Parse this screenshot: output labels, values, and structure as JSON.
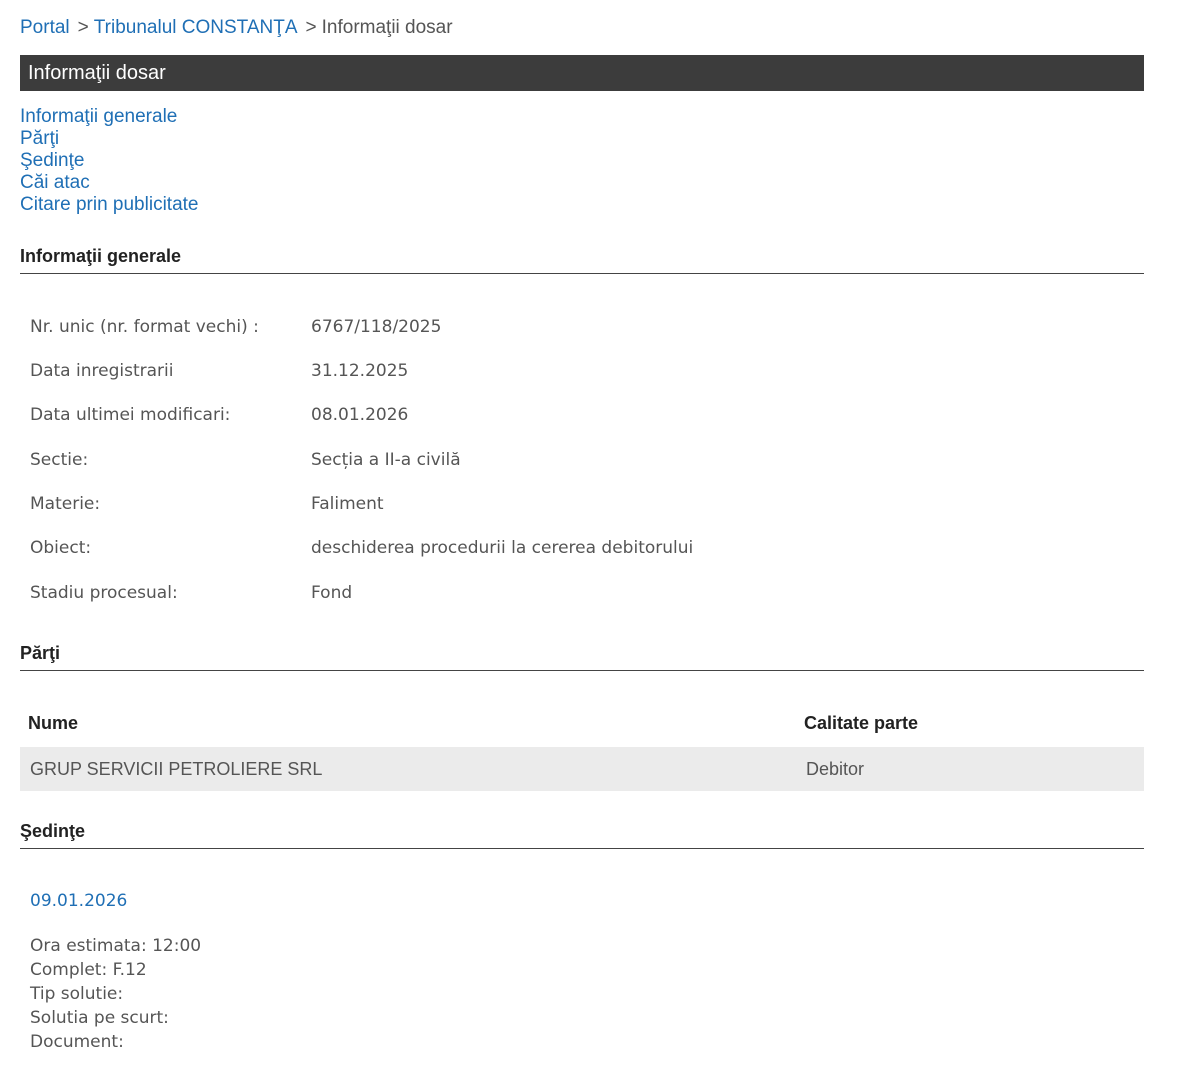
{
  "breadcrumb": {
    "portal": "Portal",
    "separator": ">",
    "court": "Tribunalul CONSTANŢA",
    "current": "Informaţii dosar"
  },
  "title_bar": "Informaţii dosar",
  "toc": [
    "Informaţii generale",
    "Părţi",
    "Şedinţe",
    "Căi atac",
    "Citare prin publicitate"
  ],
  "general": {
    "heading": "Informaţii generale",
    "rows": [
      {
        "label": "Nr. unic (nr. format vechi) :",
        "value": "6767/118/2025"
      },
      {
        "label": "Data inregistrarii",
        "value": "31.12.2025"
      },
      {
        "label": "Data ultimei modificari:",
        "value": "08.01.2026"
      },
      {
        "label": "Sectie:",
        "value": "Secția a II-a civilă"
      },
      {
        "label": "Materie:",
        "value": "Faliment"
      },
      {
        "label": "Obiect:",
        "value": "deschiderea procedurii la cererea debitorului"
      },
      {
        "label": "Stadiu procesual:",
        "value": "Fond"
      }
    ]
  },
  "parties": {
    "heading": "Părţi",
    "col_name": "Nume",
    "col_role": "Calitate parte",
    "rows": [
      {
        "name": "GRUP SERVICII PETROLIERE SRL",
        "role": "Debitor"
      }
    ]
  },
  "hearings": {
    "heading": "Şedinţe",
    "date": "09.01.2026",
    "details": [
      "Ora estimata: 12:00",
      "Complet: F.12",
      "Tip solutie:",
      "Solutia pe scurt:",
      "Document:"
    ]
  },
  "colors": {
    "link": "#1f6fb5",
    "title_bar_bg": "#3c3c3c",
    "row_bg": "#ebebeb",
    "text": "#555555"
  }
}
